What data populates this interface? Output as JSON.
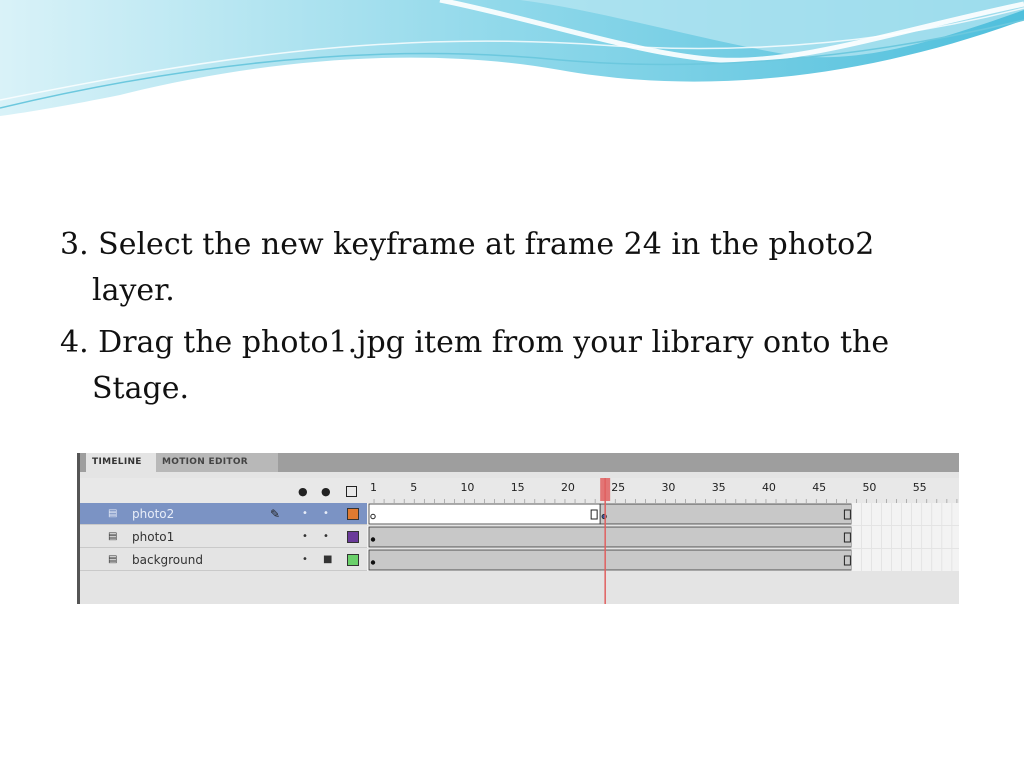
{
  "slide": {
    "step3": "3. Select the new keyframe at frame 24 in the photo2 layer.",
    "step4": "4. Drag the photo1.jpg item from your library onto the Stage."
  },
  "timeline": {
    "tabs": [
      "TIMELINE",
      "MOTION EDITOR"
    ],
    "column_icons": [
      "eye-icon",
      "lock-icon",
      "outline-icon"
    ],
    "frame_numbers": [
      1,
      5,
      10,
      15,
      20,
      25,
      30,
      35,
      40,
      45,
      50,
      55
    ],
    "playhead_frame": 24,
    "total_frames": 48,
    "layers": [
      {
        "name": "photo2",
        "selected": true,
        "color": "#e07a30",
        "locked": false,
        "keyframes": [
          1,
          24
        ],
        "empty_start": true
      },
      {
        "name": "photo1",
        "selected": false,
        "color": "#6a3a9a",
        "locked": false,
        "keyframes": [
          1
        ],
        "empty_start": false
      },
      {
        "name": "background",
        "selected": false,
        "color": "#6ad06a",
        "locked": true,
        "keyframes": [
          1
        ],
        "empty_start": false
      }
    ]
  },
  "colors": {
    "selection": "#7b93c4",
    "playhead": "#e06060",
    "wave_light": "#c8ecf4",
    "wave_dark": "#5cc4de"
  }
}
